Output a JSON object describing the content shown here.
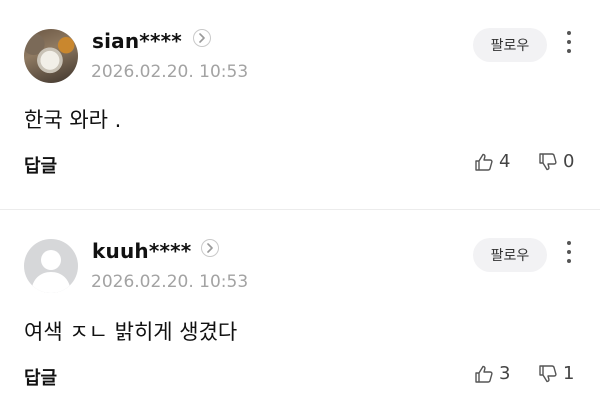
{
  "comments": [
    {
      "username": "sian****",
      "timestamp": "2026.02.20. 10:53",
      "follow_label": "팔로우",
      "text": "한국 와라 .",
      "reply_label": "답글",
      "likes": "4",
      "dislikes": "0"
    },
    {
      "username": "kuuh****",
      "timestamp": "2026.02.20. 10:53",
      "follow_label": "팔로우",
      "text": "여색 ㅈㄴ 밝히게 생겼다",
      "reply_label": "답글",
      "likes": "3",
      "dislikes": "1"
    }
  ],
  "icons": {
    "profile_arrow": "chevron-right-icon",
    "more": "more-vertical-icon",
    "like": "thumbs-up-icon",
    "dislike": "thumbs-down-icon",
    "default_avatar": "user-icon"
  }
}
